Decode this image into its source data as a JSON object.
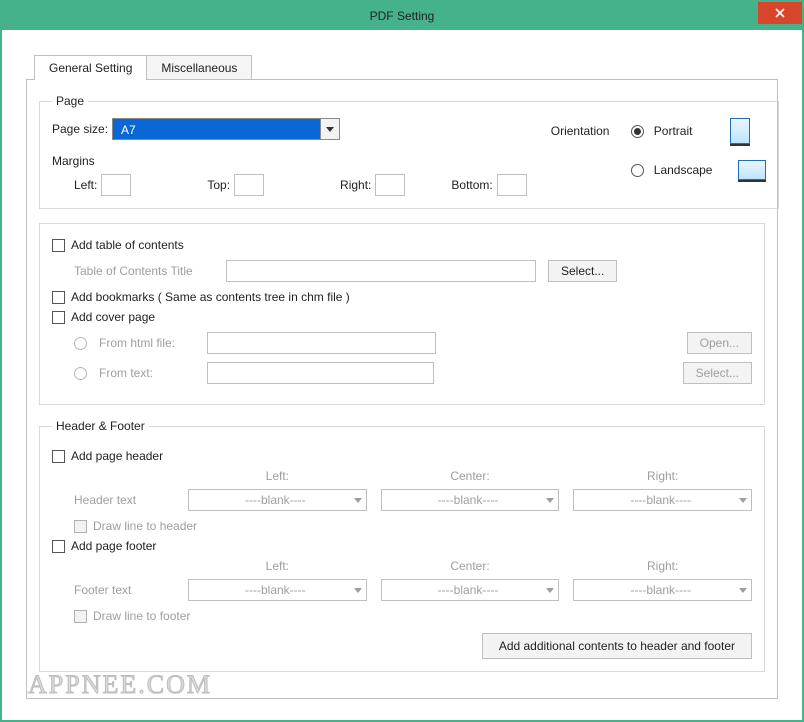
{
  "window": {
    "title": "PDF Setting"
  },
  "tabs": {
    "general": "General Setting",
    "misc": "Miscellaneous"
  },
  "page": {
    "legend": "Page",
    "size_label": "Page size:",
    "size_value": "A7",
    "orientation_label": "Orientation",
    "portrait_label": "Portrait",
    "landscape_label": "Landscape",
    "margins_label": "Margins",
    "left_label": "Left:",
    "top_label": "Top:",
    "right_label": "Right:",
    "bottom_label": "Bottom:"
  },
  "toc": {
    "add_toc_label": "Add table of contents",
    "title_label": "Table of Contents Title",
    "select_btn": "Select...",
    "add_bookmarks_label": "Add  bookmarks ( Same as contents tree in chm file )",
    "add_cover_label": "Add cover page",
    "from_html_label": "From html file:",
    "from_text_label": "From  text:",
    "open_btn": "Open...",
    "select2_btn": "Select..."
  },
  "hf": {
    "legend": "Header & Footer",
    "add_header_label": "Add page header",
    "header_text_label": "Header text",
    "add_footer_label": "Add page footer",
    "footer_text_label": "Footer text",
    "left_col": "Left:",
    "center_col": "Center:",
    "right_col": "Right:",
    "blank_value": "----blank----",
    "draw_line_header": "Draw line to header",
    "draw_line_footer": "Draw line to footer",
    "additional_btn": "Add additional contents to header and footer"
  },
  "watermark": "APPNEE.COM"
}
